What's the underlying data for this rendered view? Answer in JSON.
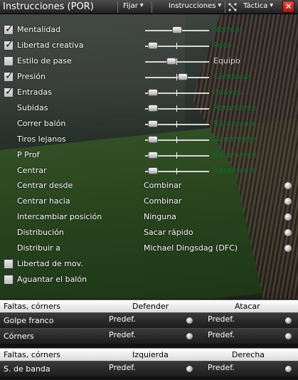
{
  "window": {
    "title": "Instrucciones (POR)",
    "menu_fijar": "Fijar",
    "menu_instrucciones": "Instrucciones",
    "menu_tactica": "Táctica",
    "close_label": "✕"
  },
  "colors": {
    "slider_value": "#0d6b2a",
    "close": "#c8281c"
  },
  "sliders": [
    {
      "label": "Mentalidad",
      "checked": true,
      "value": "Normal",
      "level": 0.5,
      "active": true
    },
    {
      "label": "Libertad creativa",
      "checked": true,
      "value": "Poco",
      "level": 0.05,
      "active": true
    },
    {
      "label": "Estilo de pase",
      "checked": false,
      "value": "Equipo",
      "level": 0.4,
      "active": false
    },
    {
      "label": "Presión",
      "checked": true,
      "value": "Combinar",
      "level": 0.6,
      "active": true
    },
    {
      "label": "Entradas",
      "checked": true,
      "value": "Suaves",
      "level": 0.05,
      "active": true
    },
    {
      "label": "Subidas",
      "checked": null,
      "value": "Raramente",
      "level": 0.05,
      "active": true
    },
    {
      "label": "Correr balón",
      "checked": null,
      "value": "Raramente",
      "level": 0.05,
      "active": true
    },
    {
      "label": "Tiros lejanos",
      "checked": null,
      "value": "Raramente",
      "level": 0.05,
      "active": true
    },
    {
      "label": "P Prof",
      "checked": null,
      "value": "Raramente",
      "level": 0.05,
      "active": true
    },
    {
      "label": "Centrar",
      "checked": null,
      "value": "Raramente",
      "level": 0.05,
      "active": true
    }
  ],
  "dropdowns": [
    {
      "label": "Centrar desde",
      "value": "Combinar"
    },
    {
      "label": "Centrar hacia",
      "value": "Combinar"
    },
    {
      "label": "Intercambiar posición",
      "value": "Ninguna"
    },
    {
      "label": "Distribución",
      "value": "Sacar rápido"
    },
    {
      "label": "Distribuir a",
      "value": "Michael Dingsdag (DFC)"
    }
  ],
  "checkboxes": [
    {
      "label": "Libertad de mov.",
      "checked": false
    },
    {
      "label": "Aguantar el balón",
      "checked": false
    }
  ],
  "setpieces1": {
    "header": {
      "c0": "Faltas, córners",
      "c1": "Defender",
      "c2": "Atacar"
    },
    "rows": [
      {
        "label": "Golpe franco",
        "v1": "Predef.",
        "v2": "Predef."
      },
      {
        "label": "Córners",
        "v1": "Predef.",
        "v2": "Predef."
      }
    ]
  },
  "setpieces2": {
    "header": {
      "c0": "Faltas, córners",
      "c1": "Izquierda",
      "c2": "Derecha"
    },
    "rows": [
      {
        "label": "S. de banda",
        "v1": "Predef.",
        "v2": "Predef."
      }
    ]
  }
}
